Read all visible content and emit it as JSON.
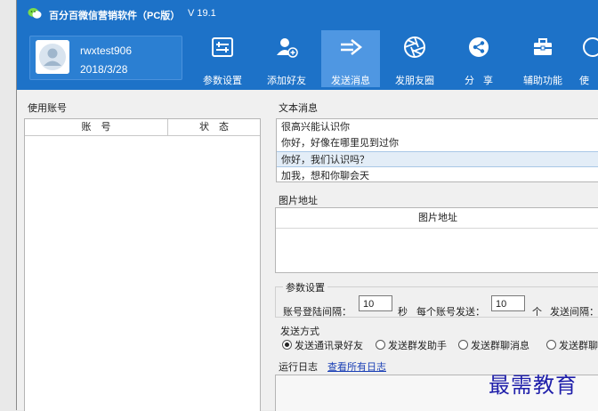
{
  "app": {
    "title": "百分百微信营销软件（PC版）",
    "version": "V 19.1"
  },
  "user": {
    "name": "rwxtest906",
    "date": "2018/3/28"
  },
  "toolbar": [
    {
      "label": "参数设置",
      "icon": "settings-icon"
    },
    {
      "label": "添加好友",
      "icon": "add-friend-icon"
    },
    {
      "label": "发送消息",
      "icon": "send-arrow-icon",
      "active": true
    },
    {
      "label": "发朋友圈",
      "icon": "aperture-icon"
    },
    {
      "label": "分享",
      "icon": "share-icon"
    },
    {
      "label": "辅助功能",
      "icon": "toolbox-icon"
    },
    {
      "label": "使",
      "icon": "partial-icon"
    }
  ],
  "accounts": {
    "section_label": "使用账号",
    "col_account": "账　号",
    "col_status": "状　态"
  },
  "messages": {
    "section_label": "文本消息",
    "items": [
      "很高兴能认识你",
      "你好，好像在哪里见到过你",
      "你好，我们认识吗？",
      "加我，想和你聊会天"
    ],
    "selected_index": 2
  },
  "images": {
    "section_label": "图片地址",
    "col_header": "图片地址"
  },
  "params": {
    "section_label": "参数设置",
    "login_interval_label": "账号登陆间隔：",
    "login_interval_value": "10",
    "login_interval_unit": "秒",
    "per_account_label": "每个账号发送：",
    "per_account_value": "10",
    "per_account_unit": "个",
    "send_interval_label": "发送间隔："
  },
  "send_mode": {
    "section_label": "发送方式",
    "options": [
      "发送通讯录好友",
      "发送群发助手",
      "发送群聊消息",
      "发送群聊"
    ],
    "selected_index": 0
  },
  "log": {
    "label": "运行日志",
    "link": "查看所有日志"
  },
  "watermark": "最需教育",
  "colors": {
    "header": "#1d72c8",
    "active_tab": "#4f97e2",
    "link": "#1a3fb5"
  }
}
